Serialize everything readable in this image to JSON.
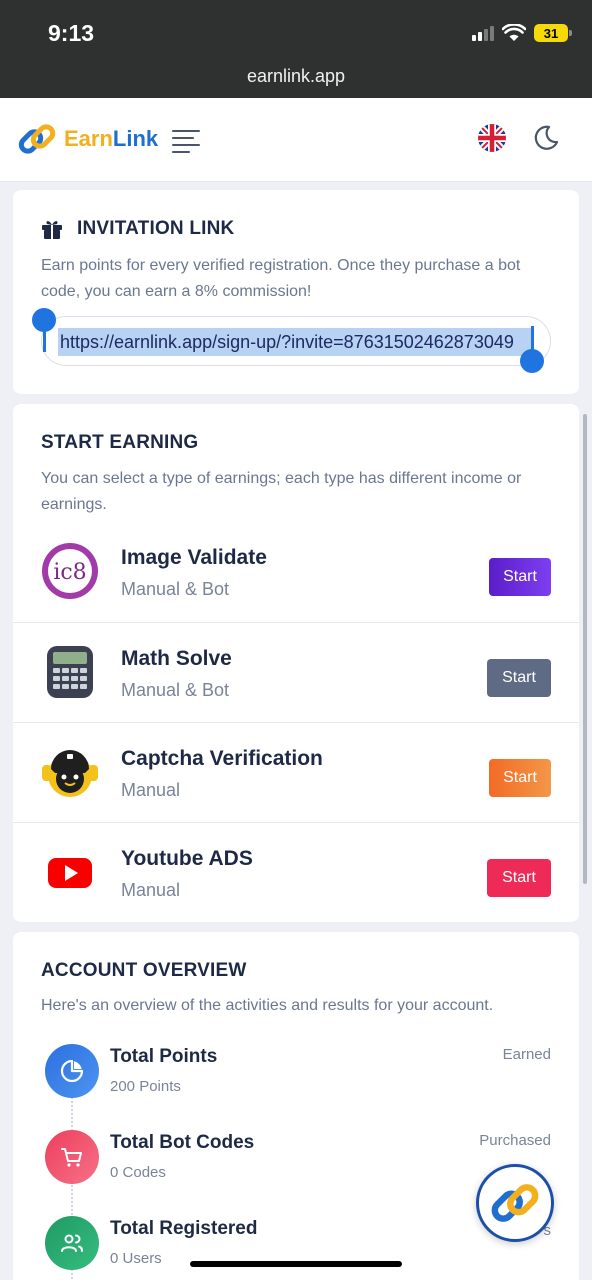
{
  "status_bar": {
    "time": "9:13",
    "battery": "31"
  },
  "browser": {
    "url": "earnlink.app"
  },
  "header": {
    "logo_earn": "Earn",
    "logo_link": "Link",
    "menu_icon": "hamburger-icon",
    "language_icon": "uk-flag-icon",
    "theme_icon": "moon-icon"
  },
  "invitation": {
    "title": "INVITATION LINK",
    "icon": "gift-icon",
    "description": "Earn points for every verified registration. Once they purchase a bot code, you can earn a 8% commission!",
    "link": "https://earnlink.app/sign-up/?invite=87631502462873049"
  },
  "earning": {
    "title": "START EARNING",
    "description": "You can select a type of earnings; each type has different income or earnings.",
    "items": [
      {
        "name": "Image Validate",
        "mode": "Manual & Bot",
        "button": "Start",
        "icon": "ic8-icon",
        "color": "#6d28d9"
      },
      {
        "name": "Math Solve",
        "mode": "Manual & Bot",
        "button": "Start",
        "icon": "calculator-icon",
        "color": "#5f6b85"
      },
      {
        "name": "Captcha Verification",
        "mode": "Manual",
        "button": "Start",
        "icon": "robot-icon",
        "color": "#f07b2e"
      },
      {
        "name": "Youtube ADS",
        "mode": "Manual",
        "button": "Start",
        "icon": "youtube-icon",
        "color": "#ee2b56"
      }
    ]
  },
  "overview": {
    "title": "ACCOUNT OVERVIEW",
    "description": "Here's an overview of the activities and results for your account.",
    "stats": [
      {
        "name": "Total Points",
        "value": "200",
        "unit": "Points",
        "tag": "Earned",
        "icon": "pie-chart-icon",
        "color": "#2f7be6"
      },
      {
        "name": "Total Bot Codes",
        "value": "0",
        "unit": "Codes",
        "tag": "Purchased",
        "icon": "cart-icon",
        "color": "#ef4f6a"
      },
      {
        "name": "Total Registered",
        "value": "0",
        "unit": "Users",
        "tag": "s",
        "icon": "users-icon",
        "color": "#22a36a"
      }
    ]
  }
}
